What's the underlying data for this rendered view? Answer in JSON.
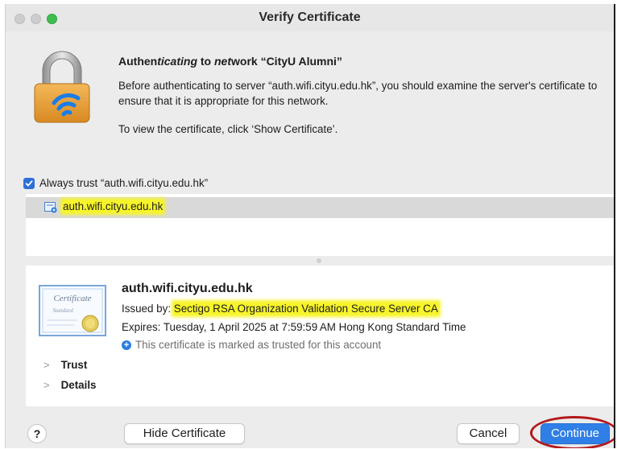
{
  "window": {
    "title": "Verify Certificate"
  },
  "message": {
    "heading_prefix": "Authen",
    "heading_italic1": "ticating",
    "heading_mid": " to ",
    "heading_italic2": "net",
    "heading_suffix": "work “CityU Alumni”",
    "paragraph": "Before authenticating to server “auth.wifi.cityu.edu.hk”, you should examine the server's certificate to ensure that it is appropriate for this network.",
    "instruction": "To view the certificate, click ‘Show Certificate’."
  },
  "always_trust": {
    "label": "Always trust “auth.wifi.cityu.edu.hk”",
    "checked": true
  },
  "cert_list": {
    "items": [
      {
        "label": "auth.wifi.cityu.edu.hk",
        "highlighted": true
      }
    ]
  },
  "certificate": {
    "name": "auth.wifi.cityu.edu.hk",
    "issued_label": "Issued by: ",
    "issuer": "Sectigo RSA Organization Validation Secure Server CA",
    "expires": "Expires: Tuesday, 1 April 2025 at 7:59:59 AM Hong Kong Standard Time",
    "trusted_note": "This certificate is marked as trusted for this account",
    "image_text1": "Certificate",
    "image_text2": "Standard"
  },
  "disclosures": {
    "trust": "Trust",
    "details": "Details"
  },
  "buttons": {
    "help": "?",
    "hide_certificate": "Hide Certificate",
    "cancel": "Cancel",
    "continue": "Continue"
  },
  "colors": {
    "accent": "#2f7fe6",
    "highlight": "#f7f42a",
    "annotation_ring": "#b3191c"
  }
}
